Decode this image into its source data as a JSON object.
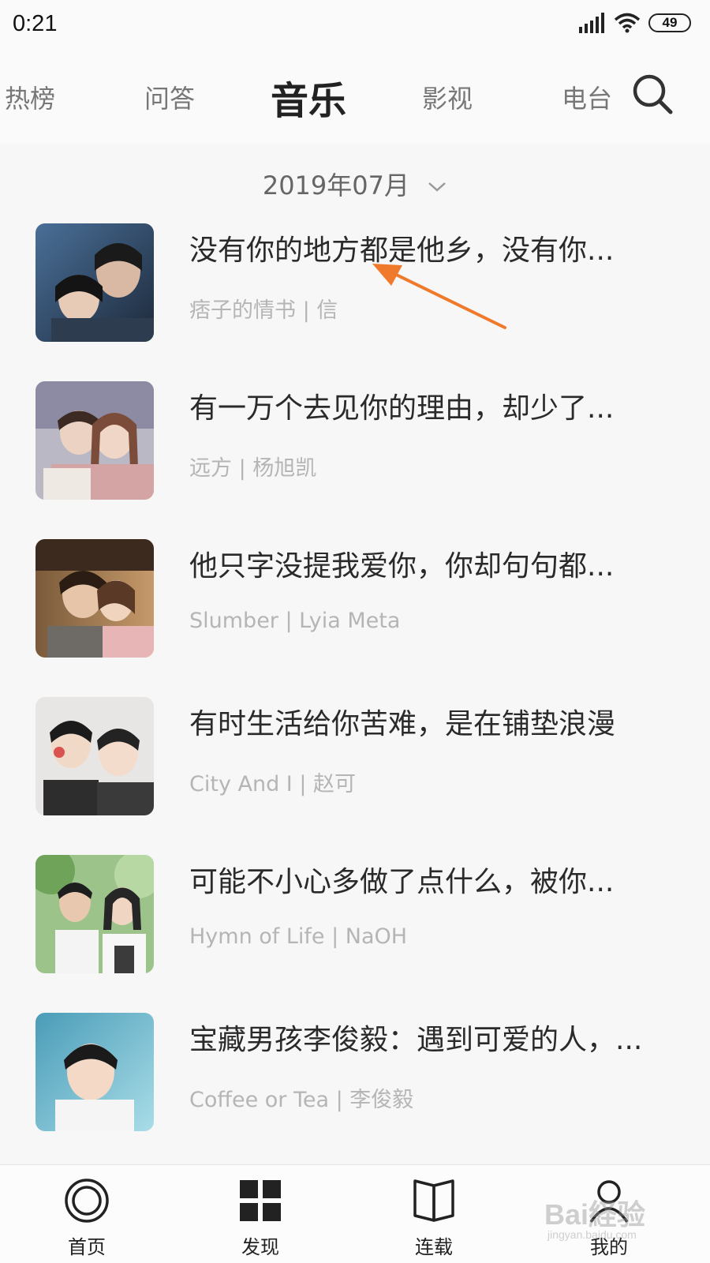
{
  "status": {
    "time": "0:21",
    "battery": "49"
  },
  "nav": {
    "tabs": [
      {
        "label": "热榜",
        "active": false
      },
      {
        "label": "问答",
        "active": false
      },
      {
        "label": "音乐",
        "active": true
      },
      {
        "label": "影视",
        "active": false
      },
      {
        "label": "电台",
        "active": false
      }
    ],
    "search_icon": "search-icon"
  },
  "date_filter": {
    "label": "2019年07月"
  },
  "songs": [
    {
      "title": "没有你的地方都是他乡，没有你...",
      "subtitle": "痞子的情书 | 信"
    },
    {
      "title": "有一万个去见你的理由，却少了...",
      "subtitle": "远方 | 杨旭凯"
    },
    {
      "title": "他只字没提我爱你，你却句句都...",
      "subtitle": "Slumber | Lyia Meta"
    },
    {
      "title": "有时生活给你苦难，是在铺垫浪漫",
      "subtitle": "City And I | 赵可"
    },
    {
      "title": "可能不小心多做了点什么，被你...",
      "subtitle": "Hymn of Life | NaOH"
    },
    {
      "title": "宝藏男孩李俊毅：遇到可爱的人，...",
      "subtitle": "Coffee or Tea | 李俊毅"
    }
  ],
  "bottom_nav": [
    {
      "label": "首页",
      "icon": "home-circle-icon"
    },
    {
      "label": "发现",
      "icon": "grid-icon"
    },
    {
      "label": "连载",
      "icon": "book-icon"
    },
    {
      "label": "我的",
      "icon": "person-icon"
    }
  ],
  "watermark": {
    "main": "Bai経验",
    "sub": "jingyan.baidu.com"
  },
  "colors": {
    "annotation_arrow": "#f07a2c",
    "text_primary": "#2a2a2a",
    "text_secondary": "#b5b5b5"
  }
}
